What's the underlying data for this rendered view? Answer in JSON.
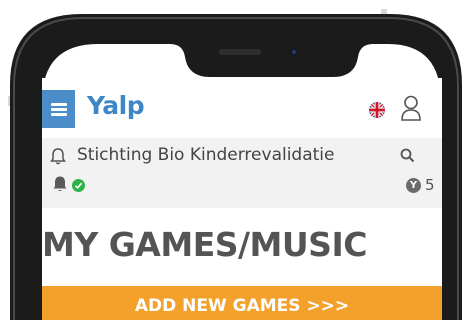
{
  "header": {
    "logo_text": "Yalp",
    "menu_icon": "hamburger-icon",
    "language_icon": "uk-flag-icon",
    "user_icon": "user-icon"
  },
  "organization": {
    "name": "Stichting Bio Kinderrevalidatie",
    "notification_icon": "bell-outline-icon",
    "search_icon": "search-icon"
  },
  "status": {
    "bell_icon": "bell-filled-icon",
    "check_icon": "check-circle-icon",
    "coin_symbol": "Y",
    "coin_count": "5"
  },
  "main": {
    "title": "MY GAMES/MUSIC",
    "add_button_label": "ADD NEW GAMES >>>"
  },
  "colors": {
    "brand_blue": "#3f86c7",
    "accent_orange": "#f3a12b",
    "success_green": "#2db34a"
  }
}
